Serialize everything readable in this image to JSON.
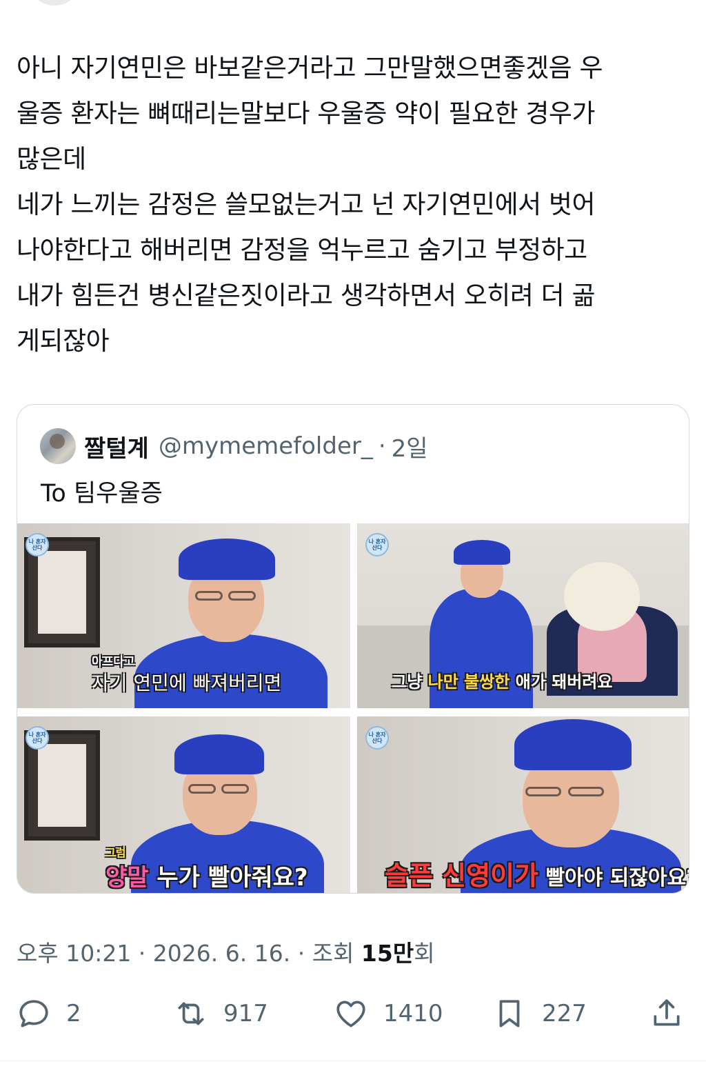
{
  "tweet": {
    "text": "아니 자기연민은 바보같은거라고 그만말했으면좋겠음 우\n울증 환자는 뼈때리는말보다 우울증 약이 필요한 경우가\n많은데\n네가 느끼는 감정은 쓸모없는거고 넌 자기연민에서 벗어\n나야한다고 해버리면 감정을 억누르고 숨기고 부정하고\n내가 힘든건 병신같은짓이라고 생각하면서 오히려 더 곪\n게되잖아"
  },
  "quote": {
    "name": "짤털계",
    "handle": "@mymemefolder_",
    "separator": "·",
    "time": "2일",
    "text": "To 팀우울증",
    "media": [
      {
        "caption_top": "아프다고",
        "caption_main": "자기 연민에 빠져버리면"
      },
      {
        "caption_pre": "그냥 ",
        "caption_highlight": "나만 불쌍한",
        "caption_post": " 애가 돼버려요"
      },
      {
        "caption_top": "그럼",
        "caption_main": "양말",
        "caption_post": " 누가 빨아줘요?"
      },
      {
        "caption_main": "슬픈 신영이가",
        "caption_post": " 빨아야 되잖아요?"
      }
    ],
    "badge_text": "나 혼자 산다"
  },
  "meta": {
    "time": "오후 10:21",
    "sep1": " · ",
    "date": "2026. 6. 16.",
    "sep2": " · ",
    "views_label": "조회 ",
    "views_value": "15만",
    "views_suffix": "회"
  },
  "actions": {
    "reply_count": "2",
    "retweet_count": "917",
    "like_count": "1410",
    "bookmark_count": "227"
  },
  "colors": {
    "text_primary": "#0f1419",
    "text_secondary": "#536471",
    "border": "#cfd9de",
    "shirt_blue": "#2d48c9"
  },
  "icons": [
    "reply-icon",
    "retweet-icon",
    "like-icon",
    "bookmark-icon",
    "share-icon"
  ]
}
